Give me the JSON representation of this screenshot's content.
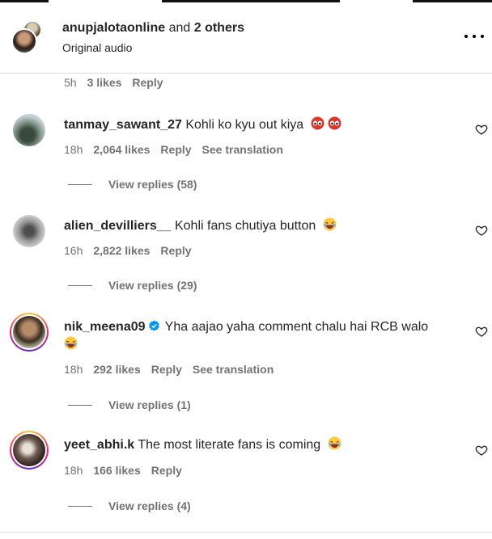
{
  "header": {
    "user": "anupjalotaonline",
    "joiner": "and",
    "others": "2 others",
    "subtitle": "Original audio",
    "more_icon": "more-horizontal-icon"
  },
  "prev_comment_meta": {
    "time": "5h",
    "likes": "3 likes",
    "reply": "Reply"
  },
  "comments": [
    {
      "username": "tanmay_sawant_27",
      "text": "Kohli ko kyu out kiya",
      "emoji": "eyes-emoji-x2",
      "time": "18h",
      "likes": "2,064 likes",
      "reply": "Reply",
      "translate": "See translation",
      "view_replies": "View replies (58)"
    },
    {
      "username": "alien_devilliers__",
      "text": "Kohli fans chutiya button",
      "emoji": "laughing-emoji",
      "time": "16h",
      "likes": "2,822 likes",
      "reply": "Reply",
      "view_replies": "View replies (29)"
    },
    {
      "username": "nik_meena09",
      "verified": true,
      "text": "Yha aajao yaha comment chalu hai RCB walo",
      "emoji": "laughing-emoji",
      "time": "18h",
      "likes": "292 likes",
      "reply": "Reply",
      "translate": "See translation",
      "view_replies": "View replies (1)"
    },
    {
      "username": "yeet_abhi.k",
      "text": "The most literate fans is coming",
      "emoji": "laughing-emoji",
      "time": "18h",
      "likes": "166 likes",
      "reply": "Reply",
      "view_replies": "View replies (4)"
    }
  ],
  "colors": {
    "text": "#262626",
    "muted": "#737373",
    "divider": "#dbdbdb",
    "verified": "#0095f6"
  }
}
